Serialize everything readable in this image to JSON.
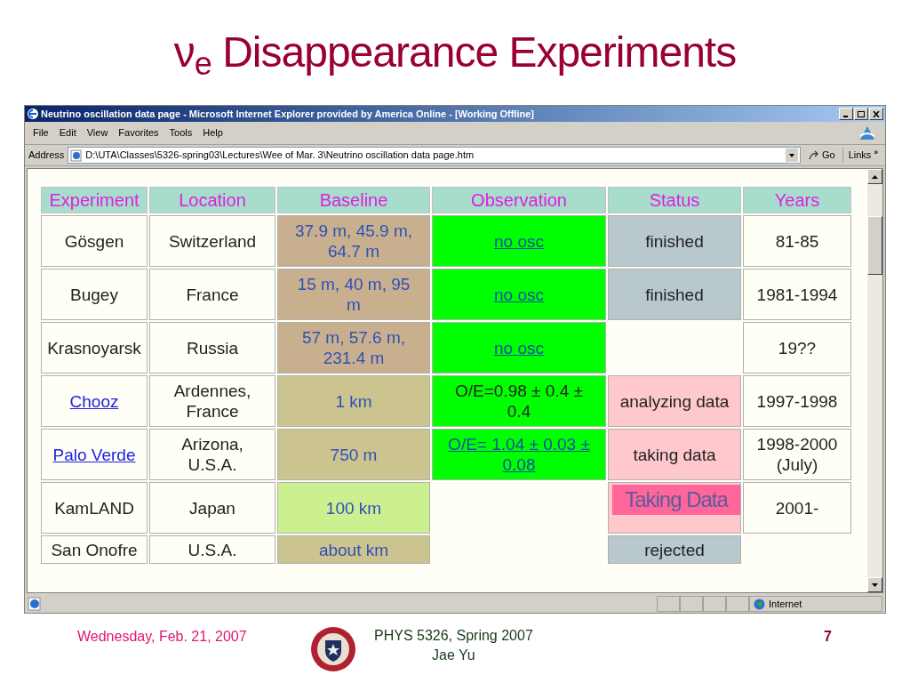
{
  "slide": {
    "title": "ν$_{e}$ Disappearance Experiments",
    "footer": {
      "date": "Wednesday, Feb. 21, 2007",
      "course": "PHYS 5326, Spring 2007",
      "author": "Jae Yu",
      "page": "7"
    }
  },
  "browser": {
    "title": "Neutrino oscillation data page - Microsoft Internet Explorer provided by America Online - [Working Offline]",
    "menu": [
      "File",
      "Edit",
      "View",
      "Favorites",
      "Tools",
      "Help"
    ],
    "address_label": "Address",
    "address": "D:\\UTA\\Classes\\5326-spring03\\Lectures\\Wee of Mar. 3\\Neutrino oscillation data page.htm",
    "go": "Go",
    "links": "Links",
    "links_more": "»",
    "zone": "Internet"
  },
  "table": {
    "columns": [
      "Experiment",
      "Location",
      "Baseline",
      "Observation",
      "Status",
      "Years"
    ],
    "rows": [
      {
        "cells": [
          {
            "kind": "text",
            "text": "Gösgen",
            "color": "#fffff6"
          },
          {
            "kind": "text",
            "text": "Switzerland",
            "color": "#fffff6"
          },
          {
            "kind": "text",
            "text": "37.9 m, 45.9 m, 64.7 m",
            "color": "#c8b08e"
          },
          {
            "kind": "link",
            "text": "no osc",
            "color": "#00ff00"
          },
          {
            "kind": "text",
            "text": "finished",
            "color": "#b8c8cc"
          },
          {
            "kind": "text",
            "text": "81-85",
            "color": "#fffff6"
          }
        ]
      },
      {
        "cells": [
          {
            "kind": "text",
            "text": "Bugey",
            "color": "#fffff6"
          },
          {
            "kind": "text",
            "text": "France",
            "color": "#fffff6"
          },
          {
            "kind": "text",
            "text": "15 m, 40 m, 95 m",
            "color": "#c8b08e"
          },
          {
            "kind": "link",
            "text": "no osc",
            "color": "#00ff00"
          },
          {
            "kind": "text",
            "text": "finished",
            "color": "#b8c8cc"
          },
          {
            "kind": "text",
            "text": "1981-1994",
            "color": "#fffff6"
          }
        ]
      },
      {
        "cells": [
          {
            "kind": "text",
            "text": "Krasnoyarsk",
            "color": "#fffff6"
          },
          {
            "kind": "text",
            "text": "Russia",
            "color": "#fffff6"
          },
          {
            "kind": "text",
            "text": "57 m, 57.6 m, 231.4 m",
            "color": "#c8b08e"
          },
          {
            "kind": "link",
            "text": "no osc",
            "color": "#00ff00"
          },
          {
            "kind": "empty"
          },
          {
            "kind": "text",
            "text": "19??",
            "color": "#fffff6"
          }
        ]
      },
      {
        "cells": [
          {
            "kind": "link",
            "text": "Chooz",
            "color": "#fffff6"
          },
          {
            "kind": "text",
            "text": "Ardennes, France",
            "color": "#fffff6"
          },
          {
            "kind": "text",
            "text": "1 km",
            "color": "#ccc48e"
          },
          {
            "kind": "text",
            "text": "O/E=0.98 ± 0.4 ± 0.4",
            "color": "#00ff00"
          },
          {
            "kind": "text",
            "text": "analyzing data",
            "color": "#ffc8cc"
          },
          {
            "kind": "text",
            "text": "1997-1998",
            "color": "#fffff6"
          }
        ]
      },
      {
        "cells": [
          {
            "kind": "link",
            "text": "Palo Verde",
            "color": "#fffff6"
          },
          {
            "kind": "text",
            "text": "Arizona, U.S.A.",
            "color": "#fffff6"
          },
          {
            "kind": "text",
            "text": "750 m",
            "color": "#ccc48e"
          },
          {
            "kind": "link",
            "text": "O/E= 1.04 ± 0.03 ± 0.08",
            "color": "#00ff00"
          },
          {
            "kind": "text",
            "text": "taking data",
            "color": "#ffc8cc"
          },
          {
            "kind": "text",
            "text": "1998-2000 (July)",
            "color": "#fffff6"
          }
        ]
      },
      {
        "cells": [
          {
            "kind": "text",
            "text": "KamLAND",
            "color": "#fffff6"
          },
          {
            "kind": "text",
            "text": "Japan",
            "color": "#fffff6"
          },
          {
            "kind": "text",
            "text": "100 km",
            "color": "#ccf090"
          },
          {
            "kind": "empty"
          },
          {
            "kind": "overlay",
            "color": "#ffc8cc",
            "overlay": {
              "text": "Taking Data",
              "color": "#ff6699"
            }
          },
          {
            "kind": "text",
            "text": "2001-",
            "color": "#fffff6"
          }
        ]
      },
      {
        "cells": [
          {
            "kind": "text",
            "text": "San Onofre",
            "color": "#fffff6"
          },
          {
            "kind": "text",
            "text": "U.S.A.",
            "color": "#fffff6"
          },
          {
            "kind": "text",
            "text": "about km",
            "color": "#ccc48e"
          },
          {
            "kind": "empty"
          },
          {
            "kind": "text",
            "text": "rejected",
            "color": "#b8c8cc"
          },
          {
            "kind": "empty"
          }
        ]
      }
    ]
  }
}
